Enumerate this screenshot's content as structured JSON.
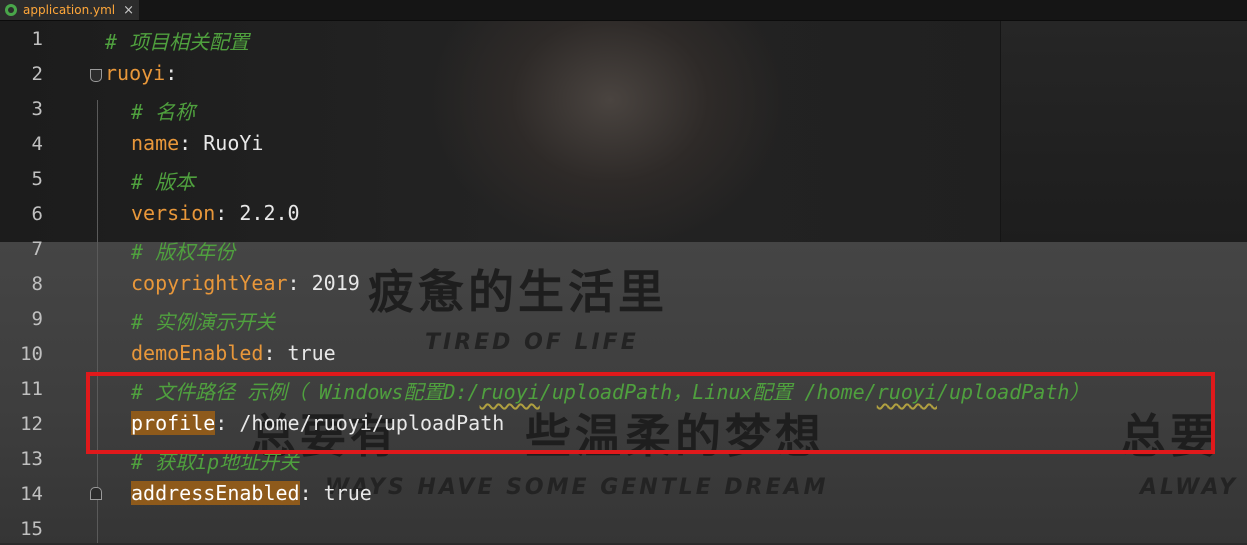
{
  "tab": {
    "title": "application.yml",
    "close": "×"
  },
  "watermark": {
    "cn1": "疲惫的生活里",
    "en1": "TIRED OF LIFE",
    "cn2a": "总要有",
    "cn2b": "些温柔的梦想",
    "cn2c": "总要",
    "en2": "WAYS HAVE SOME GENTLE DREAM",
    "en3": "ALWAY"
  },
  "lines": [
    {
      "n": "1",
      "comment": "# 项目相关配置"
    },
    {
      "n": "2",
      "key": "ruoyi",
      "colon": ":"
    },
    {
      "n": "3",
      "comment": "# 名称"
    },
    {
      "n": "4",
      "key": "name",
      "colon": ":",
      "value": " RuoYi"
    },
    {
      "n": "5",
      "comment": "# 版本"
    },
    {
      "n": "6",
      "key": "version",
      "colon": ":",
      "value": " 2.2.0"
    },
    {
      "n": "7",
      "comment": "# 版权年份"
    },
    {
      "n": "8",
      "key": "copyrightYear",
      "colon": ":",
      "value": " 2019"
    },
    {
      "n": "9",
      "comment": "# 实例演示开关"
    },
    {
      "n": "10",
      "key": "demoEnabled",
      "colon": ":",
      "value": " true"
    },
    {
      "n": "11",
      "comment_a": "# 文件路径 示例（ Windows配置D:/",
      "comment_b": "ruoyi",
      "comment_c": "/uploadPath，Linux配置 /home/",
      "comment_d": "ruoyi",
      "comment_e": "/uploadPath）"
    },
    {
      "n": "12",
      "key": "profile",
      "colon": ":",
      "value": " /home/ruoyi/uploadPath"
    },
    {
      "n": "13",
      "comment": "# 获取ip地址开关"
    },
    {
      "n": "14",
      "key": "addressEnabled",
      "colon": ":",
      "value": " true"
    },
    {
      "n": "15"
    }
  ],
  "colors": {
    "comment": "#4fa03e",
    "key": "#e8973a",
    "highlight": "#8e5a1b",
    "annotation_box": "#e0191b"
  }
}
